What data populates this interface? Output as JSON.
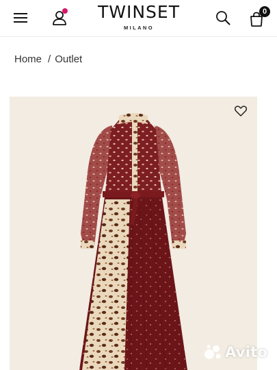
{
  "header": {
    "brand": "TWINSET",
    "brand_sub": "MILANO",
    "cart_count": "0",
    "icons": [
      "hamburger-menu-icon",
      "user-icon",
      "search-icon",
      "shopping-bag-icon"
    ],
    "accent_color": "#d6186b"
  },
  "breadcrumb": {
    "items": [
      "Home",
      "Outlet"
    ],
    "separator": "/"
  },
  "product": {
    "image": "long-printed-dress",
    "background_color": "#f2ece2",
    "favorite_icon": "heart-outline-icon"
  },
  "watermark": {
    "text": "Avito",
    "icon": "avito-dots-icon"
  }
}
